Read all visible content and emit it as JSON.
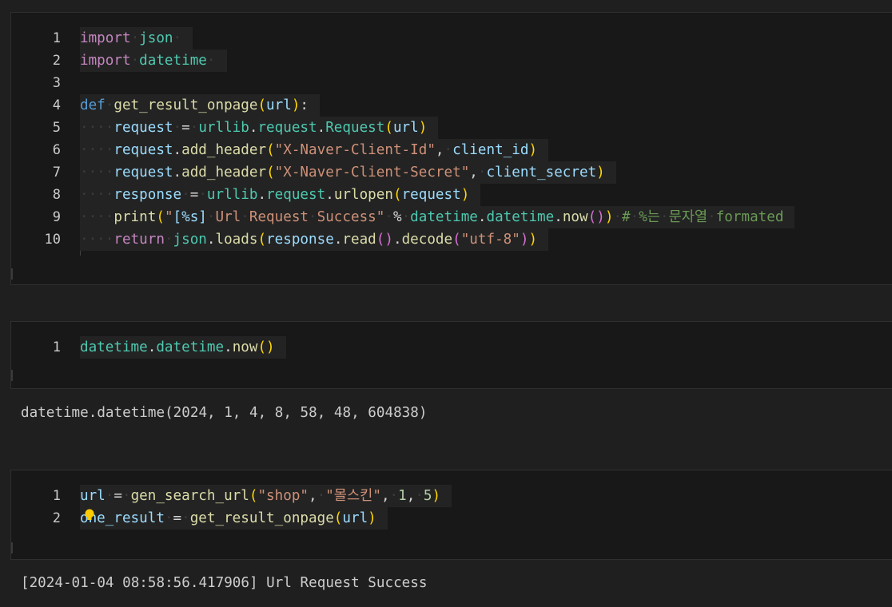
{
  "cells": [
    {
      "lines": [
        {
          "num": "1",
          "code": "import json"
        },
        {
          "num": "2",
          "code": "import datetime"
        },
        {
          "num": "3",
          "code": ""
        },
        {
          "num": "4",
          "code": "def get_result_onpage(url):"
        },
        {
          "num": "5",
          "code": "    request = urllib.request.Request(url)"
        },
        {
          "num": "6",
          "code": "    request.add_header(\"X-Naver-Client-Id\", client_id)"
        },
        {
          "num": "7",
          "code": "    request.add_header(\"X-Naver-Client-Secret\", client_secret)"
        },
        {
          "num": "8",
          "code": "    response = urllib.request.urlopen(request)"
        },
        {
          "num": "9",
          "code": "    print(\"[%s] Url Request Success\" % datetime.datetime.now()) # %는 문자열 formated"
        },
        {
          "num": "10",
          "code": "    return json.loads(response.read().decode(\"utf-8\"))"
        }
      ]
    },
    {
      "lines": [
        {
          "num": "1",
          "code": "datetime.datetime.now()"
        }
      ],
      "output": "datetime.datetime(2024, 1, 4, 8, 58, 48, 604838)"
    },
    {
      "lines": [
        {
          "num": "1",
          "code": "url = gen_search_url(\"shop\", \"몰스킨\", 1, 5)"
        },
        {
          "num": "2",
          "code": "one_result = get_result_onpage(url)"
        }
      ],
      "output": "[2024-01-04 08:58:56.417906] Url Request Success"
    }
  ],
  "colors": {
    "background": "#1f1f1f",
    "cell_background": "#181818",
    "keyword": "#c586c0",
    "function": "#dcdcaa",
    "module": "#4ec9b0",
    "variable": "#9cdcfe",
    "string": "#ce9178",
    "number": "#b5cea8",
    "comment": "#6a9955"
  },
  "icons": [
    "lightbulb-icon"
  ]
}
